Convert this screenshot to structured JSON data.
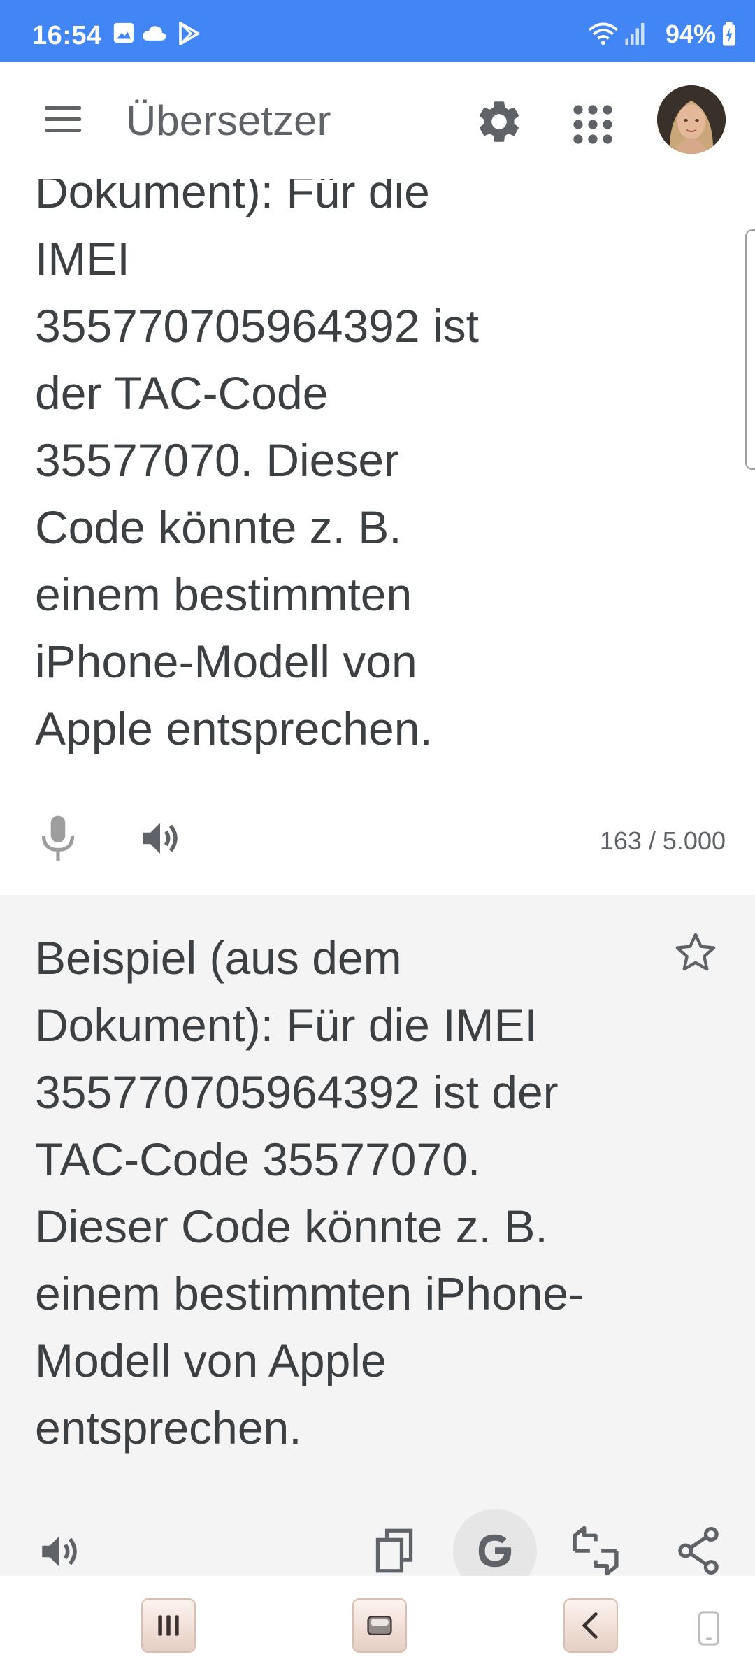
{
  "status_bar": {
    "time": "16:54",
    "battery": "94%",
    "icons": [
      "gallery-icon",
      "cloud-icon",
      "play-store-icon",
      "wifi-icon",
      "signal-icon",
      "battery-charging-icon"
    ]
  },
  "app_bar": {
    "title": "Übersetzer",
    "icons": [
      "menu-icon",
      "settings-gear-icon",
      "apps-grid-icon",
      "account-avatar"
    ]
  },
  "source": {
    "text": "Dokument): Für die\nIMEI\n355770705964392 ist\nder TAC-Code\n35577070. Dieser\nCode könnte z. B.\neinem bestimmten\niPhone-Modell von\nApple entsprechen.",
    "char_count": "163 / 5.000",
    "icons": [
      "microphone-icon",
      "speaker-icon"
    ]
  },
  "translation": {
    "text": "Beispiel (aus dem\nDokument): Für die IMEI\n355770705964392 ist der\nTAC-Code 35577070.\nDieser Code könnte z. B.\neinem bestimmten iPhone-\nModell von Apple\nentsprechen.",
    "icons": [
      "star-icon",
      "speaker-icon",
      "copy-icon",
      "google-icon",
      "feedback-icon",
      "share-icon"
    ]
  },
  "nav_bar": {
    "icons": [
      "recents-icon",
      "home-icon",
      "back-icon",
      "rotate-icon"
    ]
  },
  "colors": {
    "status_bar": "#4285f4",
    "translation_bg": "#f4f4f4",
    "text": "#3c4043",
    "icon": "#5f6368"
  }
}
